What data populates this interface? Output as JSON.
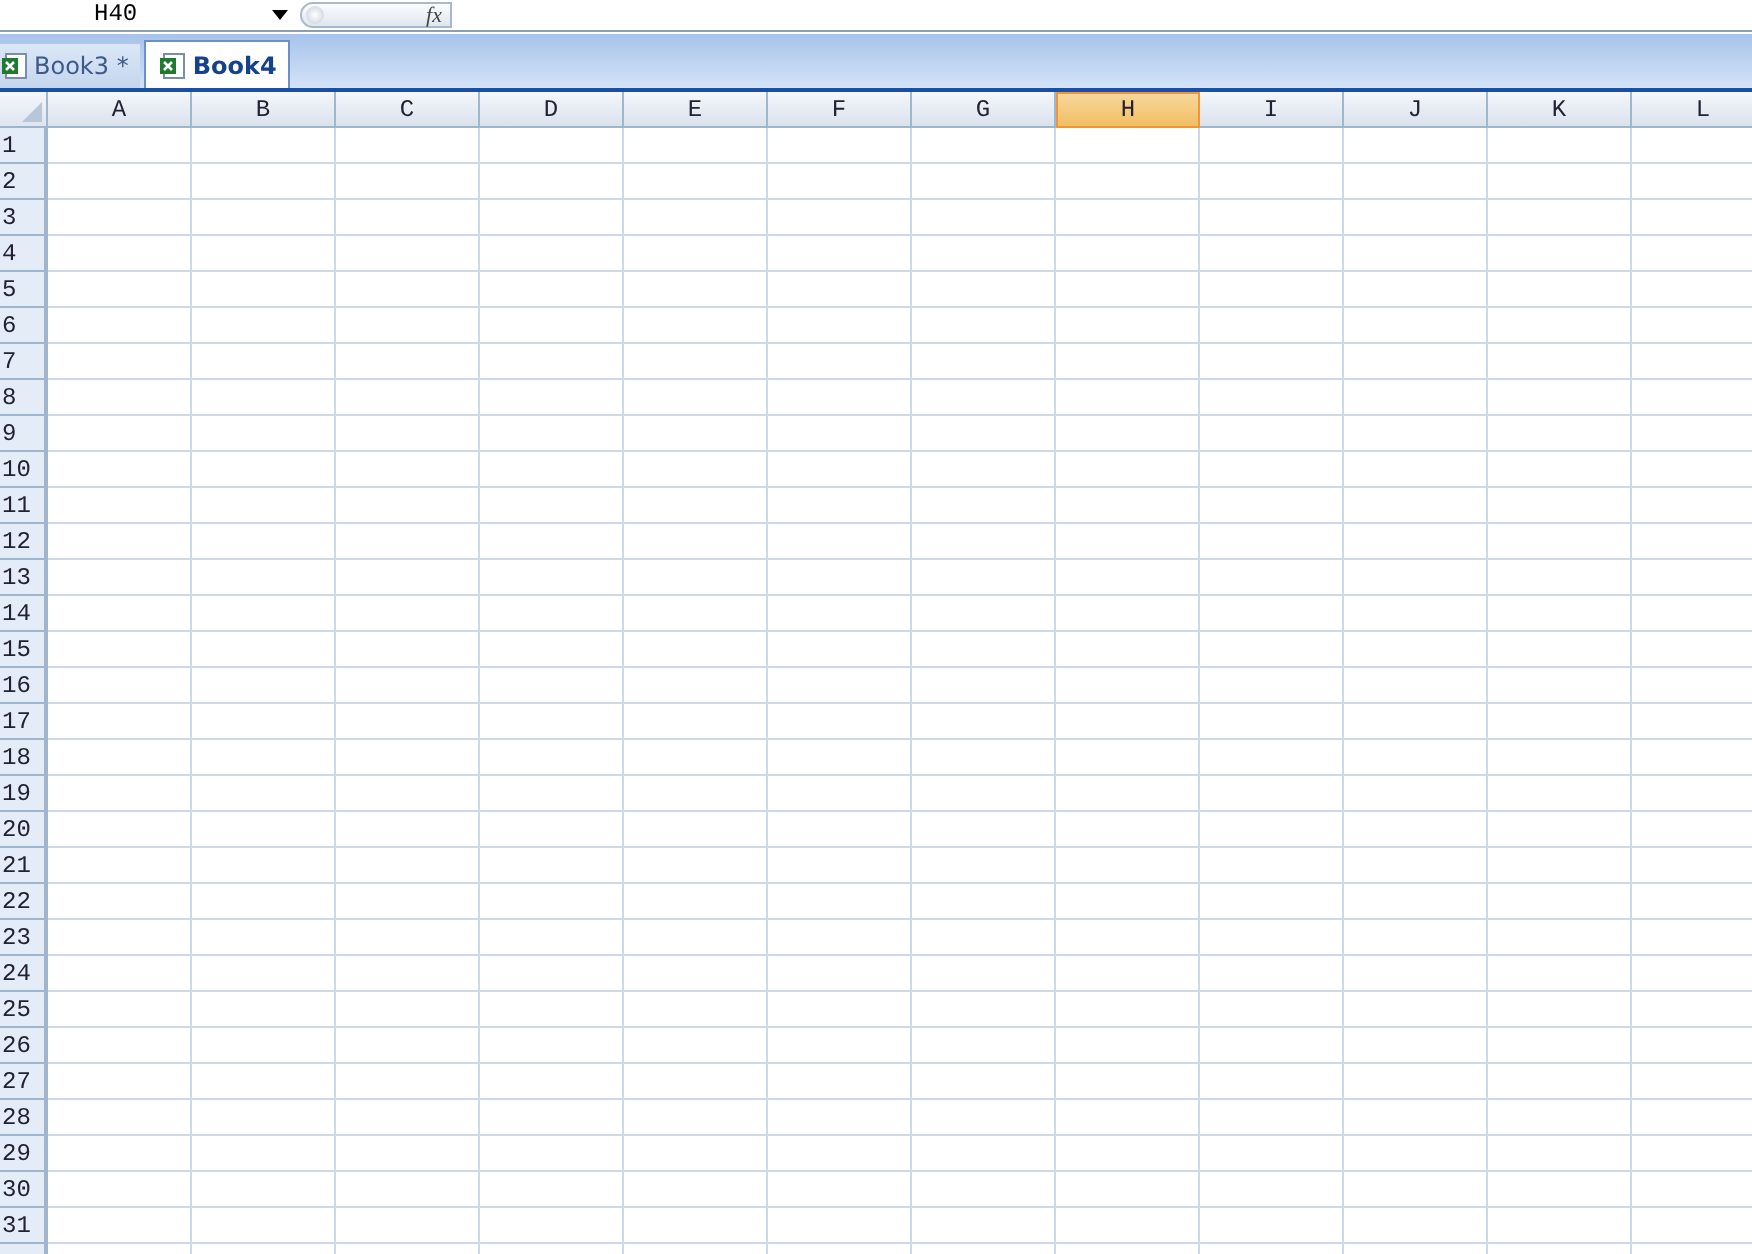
{
  "formula_bar": {
    "name_box": "H40",
    "fx": "fx"
  },
  "tabs": [
    {
      "label": "Book3 *",
      "selected": false
    },
    {
      "label": "Book4",
      "selected": true
    }
  ],
  "sheet": {
    "columns": [
      {
        "label": "A",
        "selected": false
      },
      {
        "label": "B",
        "selected": false
      },
      {
        "label": "C",
        "selected": false
      },
      {
        "label": "D",
        "selected": false
      },
      {
        "label": "E",
        "selected": false
      },
      {
        "label": "F",
        "selected": false
      },
      {
        "label": "G",
        "selected": false
      },
      {
        "label": "H",
        "selected": true
      },
      {
        "label": "I",
        "selected": false
      },
      {
        "label": "J",
        "selected": false
      },
      {
        "label": "K",
        "selected": false
      },
      {
        "label": "L",
        "selected": false
      }
    ],
    "rows": [
      "1",
      "2",
      "3",
      "4",
      "5",
      "6",
      "7",
      "8",
      "9",
      "10",
      "11",
      "12",
      "13",
      "14",
      "15",
      "16",
      "17",
      "18",
      "19",
      "20",
      "21",
      "22",
      "23",
      "24",
      "25",
      "26",
      "27",
      "28",
      "29",
      "30",
      "31"
    ]
  }
}
